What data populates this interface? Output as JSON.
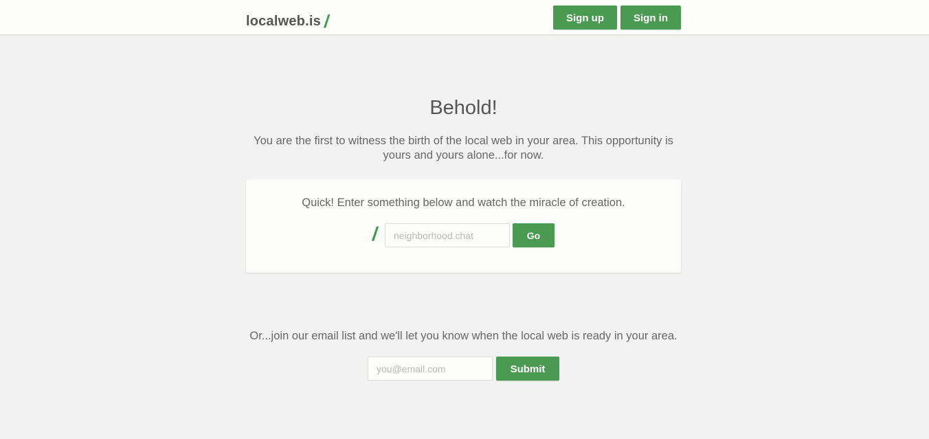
{
  "header": {
    "logo_text": "localweb.is",
    "logo_slash": "/",
    "signup_label": "Sign up",
    "signin_label": "Sign in"
  },
  "hero": {
    "title": "Behold!",
    "intro": "You are the first to witness the birth of the local web in your area. This opportunity is yours and yours alone...for now."
  },
  "create_card": {
    "prompt": "Quick! Enter something below and watch the miracle of creation.",
    "slash": "/",
    "input_placeholder": "neighborhood.chat",
    "go_label": "Go"
  },
  "email_signup": {
    "text": "Or...join our email list and we'll let you know when the local web is ready in your area.",
    "input_placeholder": "you@email.com",
    "submit_label": "Submit"
  },
  "colors": {
    "accent": "#4a9a52",
    "background": "#f1f2f1",
    "header_background": "#fcfcfa",
    "text": "#555555"
  }
}
